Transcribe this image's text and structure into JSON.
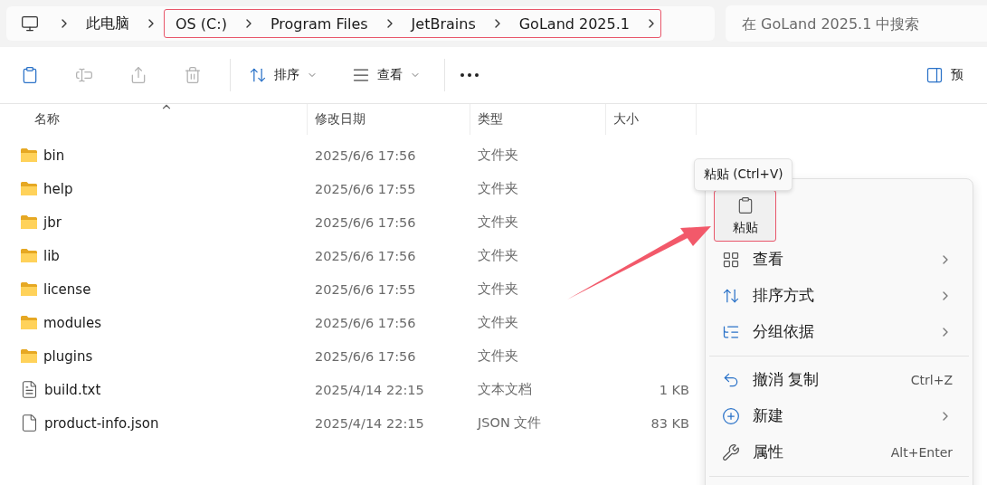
{
  "address_bar": {
    "root": "此电脑",
    "path_highlighted": true,
    "path": [
      "OS (C:)",
      "Program Files",
      "JetBrains",
      "GoLand 2025.1"
    ]
  },
  "search": {
    "placeholder": "在 GoLand 2025.1 中搜索"
  },
  "toolbar": [
    {
      "kind": "paste",
      "disabled": false
    },
    {
      "kind": "rename",
      "disabled": true
    },
    {
      "kind": "share",
      "disabled": true
    },
    {
      "kind": "delete",
      "disabled": true
    },
    {
      "kind": "sort",
      "label": "排序",
      "disabled": false
    },
    {
      "kind": "view",
      "label": "查看",
      "disabled": false
    },
    {
      "kind": "more",
      "disabled": false
    },
    {
      "kind": "preview",
      "label": "预",
      "disabled": false
    }
  ],
  "table": {
    "columns": [
      {
        "label": "名称",
        "sorted": true
      },
      {
        "label": "修改日期",
        "sorted": false
      },
      {
        "label": "类型",
        "sorted": false
      },
      {
        "label": "大小",
        "sorted": false
      }
    ],
    "rows": [
      {
        "kind": "folder",
        "name": "bin",
        "modified": "2025/6/6 17:56",
        "type": "文件夹"
      },
      {
        "kind": "folder",
        "name": "help",
        "modified": "2025/6/6 17:55",
        "type": "文件夹"
      },
      {
        "kind": "folder",
        "name": "jbr",
        "modified": "2025/6/6 17:56",
        "type": "文件夹"
      },
      {
        "kind": "folder",
        "name": "lib",
        "modified": "2025/6/6 17:56",
        "type": "文件夹"
      },
      {
        "kind": "folder",
        "name": "license",
        "modified": "2025/6/6 17:55",
        "type": "文件夹"
      },
      {
        "kind": "folder",
        "name": "modules",
        "modified": "2025/6/6 17:56",
        "type": "文件夹"
      },
      {
        "kind": "folder",
        "name": "plugins",
        "modified": "2025/6/6 17:56",
        "type": "文件夹"
      },
      {
        "kind": "text",
        "name": "build.txt",
        "modified": "2025/4/14 22:15",
        "type": "文本文档",
        "size": "1 KB"
      },
      {
        "kind": "file",
        "name": "product-info.json",
        "modified": "2025/4/14 22:15",
        "type": "JSON 文件",
        "size": "83 KB"
      }
    ]
  },
  "tooltip": "粘贴 (Ctrl+V)",
  "context_menu": {
    "top_button": {
      "label": "粘贴",
      "highlighted": true
    },
    "items": [
      {
        "kind": "view",
        "label": "查看",
        "submenu": true
      },
      {
        "kind": "sort",
        "label": "排序方式",
        "submenu": true
      },
      {
        "kind": "group",
        "label": "分组依据",
        "submenu": true
      },
      {
        "kind": "divider"
      },
      {
        "kind": "undo",
        "label": "撤消 复制",
        "shortcut": "Ctrl+Z",
        "submenu": false
      },
      {
        "kind": "new",
        "label": "新建",
        "submenu": true
      },
      {
        "kind": "properties",
        "label": "属性",
        "shortcut": "Alt+Enter",
        "submenu": false
      },
      {
        "kind": "divider"
      }
    ]
  }
}
